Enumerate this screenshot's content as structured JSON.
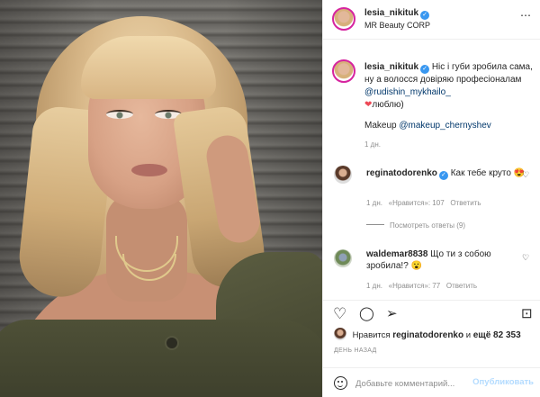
{
  "post_author": {
    "username": "lesia_nikituk",
    "location": "MR Beauty CORP"
  },
  "caption": {
    "username": "lesia_nikituk",
    "text_1": "Ніс і губи зробила сама, ну а волосся довіряю професіоналам",
    "mention_1": "@rudishin_mykhailo_",
    "heart": "❤",
    "text_2": "люблю)",
    "makeup_label": "Makeup",
    "mention_2": "@makeup_chernyshev",
    "time": "1 дн."
  },
  "comments": [
    {
      "username": "reginatodorenko",
      "text": "Как тебе круто",
      "emoji": "😍",
      "time": "1 дн.",
      "likes": "«Нравится»: 107",
      "reply": "Ответить",
      "view_replies": "Посмотреть ответы (9)"
    },
    {
      "username": "waldemar8838",
      "text": "Що ти з собою зробила!?",
      "emoji": "😮",
      "time": "1 дн.",
      "likes": "«Нравится»: 77",
      "reply": "Ответить"
    }
  ],
  "likes": {
    "prefix": "Нравится",
    "user": "reginatodorenko",
    "middle": "и",
    "rest": "ещё 82 353"
  },
  "posted_ago": "ДЕНЬ НАЗАД",
  "comment_box": {
    "placeholder": "Добавьте комментарий...",
    "post_label": "Опубликовать"
  },
  "icons": {
    "more": "⋯",
    "like": "♡",
    "comment": "◯",
    "share": "➢",
    "save": "⊡"
  },
  "colors": {
    "verified": "#3897f0",
    "link": "#00376b",
    "heart_red": "#ed4956",
    "post_disabled": "#b3dbff"
  }
}
